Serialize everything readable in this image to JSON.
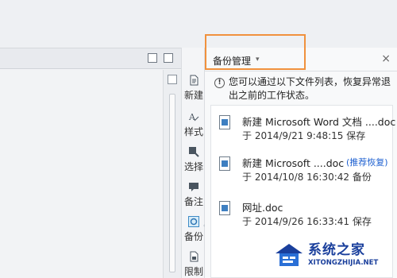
{
  "sidebar": {
    "items": [
      {
        "label": "新建",
        "icon": "new-doc-icon"
      },
      {
        "label": "样式",
        "icon": "style-icon"
      },
      {
        "label": "选择",
        "icon": "select-icon"
      },
      {
        "label": "备注",
        "icon": "comment-icon"
      },
      {
        "label": "备份",
        "icon": "backup-icon"
      },
      {
        "label": "限制",
        "icon": "restrict-icon"
      }
    ]
  },
  "panel": {
    "title": "备份管理",
    "caret": "▾",
    "close": "×",
    "info": "您可以通过以下文件列表，恢复异常退出之前的工作状态。",
    "files": [
      {
        "name": "新建 Microsoft Word 文档 ....doc",
        "meta": "于 2014/9/21 9:48:15 保存",
        "recommend": ""
      },
      {
        "name": "新建 Microsoft ....doc",
        "meta": "于 2014/10/8 16:30:42 备份",
        "recommend": "(推荐恢复)"
      },
      {
        "name": "网址.doc",
        "meta": "于 2014/9/26 16:33:41 保存",
        "recommend": ""
      }
    ]
  },
  "watermark": {
    "title": "系统之家",
    "subtitle": "XITONGZHIJIA.NET"
  },
  "colors": {
    "highlight": "#f0913d",
    "accent": "#1c5fd0",
    "watermark": "#1a3f9c"
  }
}
